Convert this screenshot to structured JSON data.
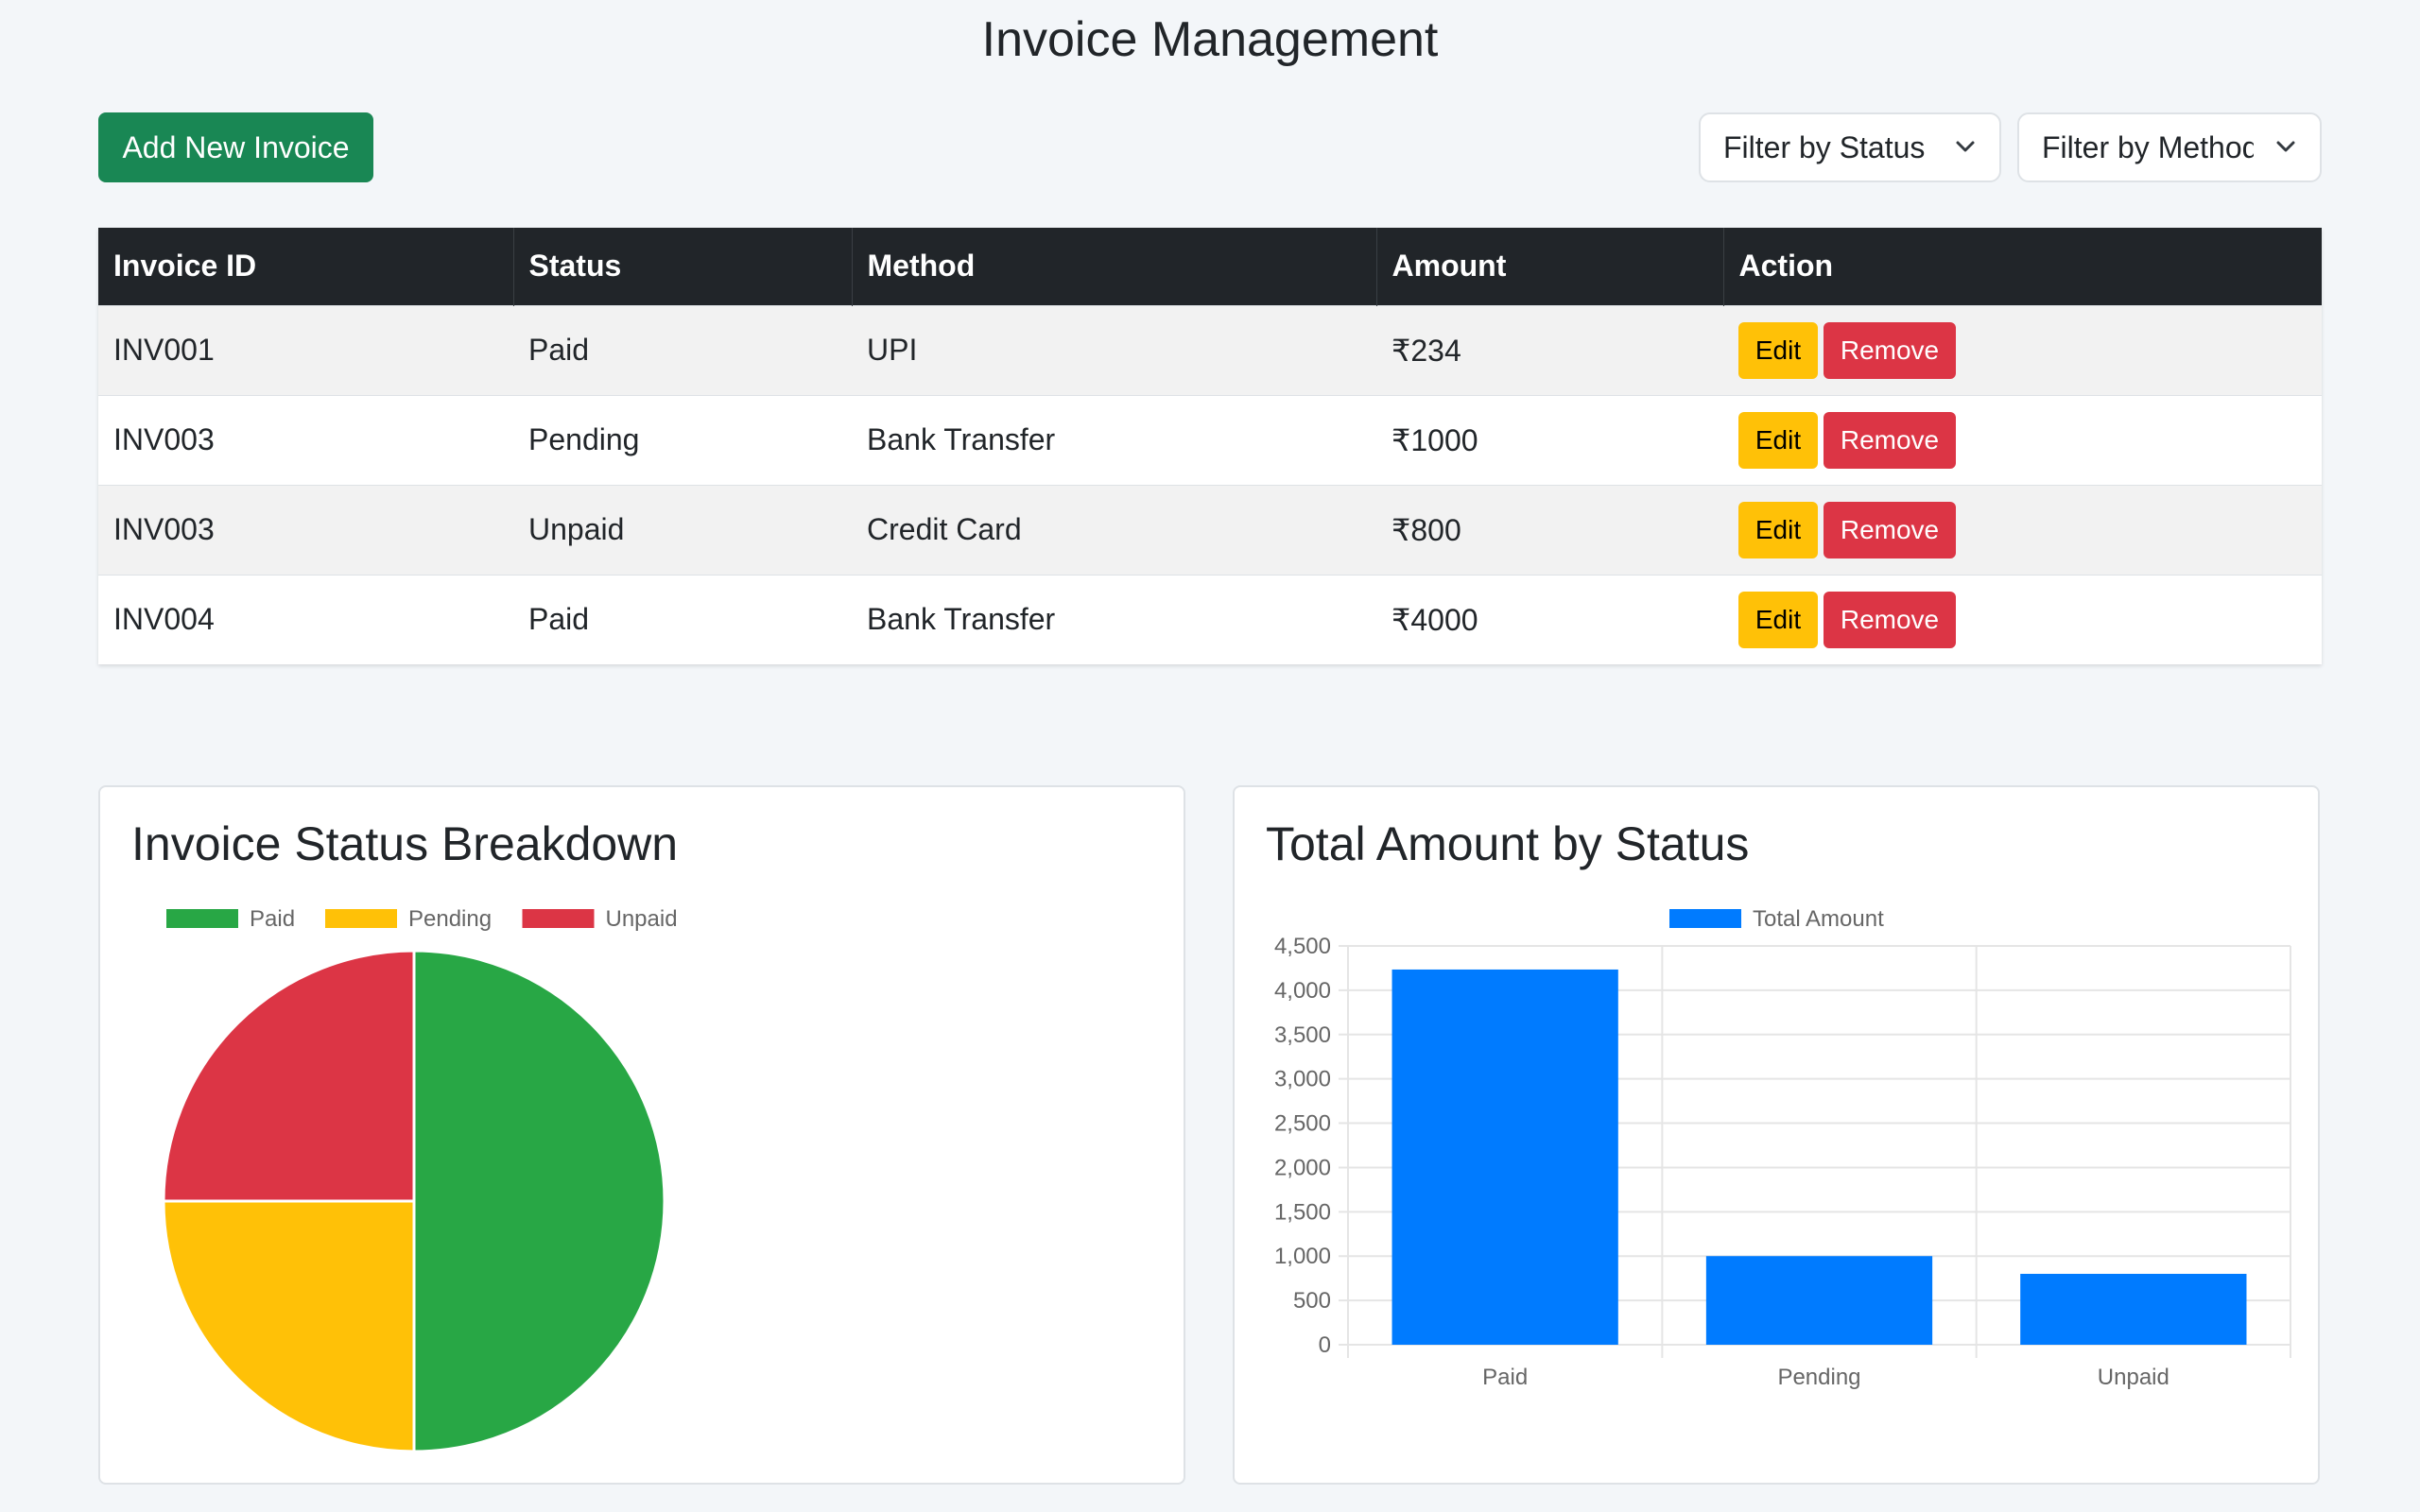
{
  "header": {
    "title": "Invoice Management"
  },
  "toolbar": {
    "add_label": "Add New Invoice",
    "filter_status_label": "Filter by Status",
    "filter_method_label": "Filter by Method"
  },
  "table": {
    "headers": [
      "Invoice ID",
      "Status",
      "Method",
      "Amount",
      "Action"
    ],
    "rows": [
      {
        "id": "INV001",
        "status": "Paid",
        "method": "UPI",
        "amount": "₹234"
      },
      {
        "id": "INV003",
        "status": "Pending",
        "method": "Bank Transfer",
        "amount": "₹1000"
      },
      {
        "id": "INV003",
        "status": "Unpaid",
        "method": "Credit Card",
        "amount": "₹800"
      },
      {
        "id": "INV004",
        "status": "Paid",
        "method": "Bank Transfer",
        "amount": "₹4000"
      }
    ],
    "edit_label": "Edit",
    "remove_label": "Remove"
  },
  "colors": {
    "paid": "#28a745",
    "pending": "#ffc107",
    "unpaid": "#dc3545",
    "bar": "#007bff",
    "add_button": "#198754"
  },
  "chart_data": [
    {
      "type": "pie",
      "title": "Invoice Status Breakdown",
      "categories": [
        "Paid",
        "Pending",
        "Unpaid"
      ],
      "values": [
        2,
        1,
        1
      ],
      "colors": [
        "#28a745",
        "#ffc107",
        "#dc3545"
      ],
      "legend": "top"
    },
    {
      "type": "bar",
      "title": "Total Amount by Status",
      "categories": [
        "Paid",
        "Pending",
        "Unpaid"
      ],
      "series": [
        {
          "name": "Total Amount",
          "values": [
            4234,
            1000,
            800
          ]
        }
      ],
      "ylim": [
        0,
        4500
      ],
      "yticks": [
        "0",
        "500",
        "1,000",
        "1,500",
        "2,000",
        "2,500",
        "3,000",
        "3,500",
        "4,000",
        "4,500"
      ],
      "grid": true,
      "legend": "top",
      "color": "#007bff"
    }
  ]
}
